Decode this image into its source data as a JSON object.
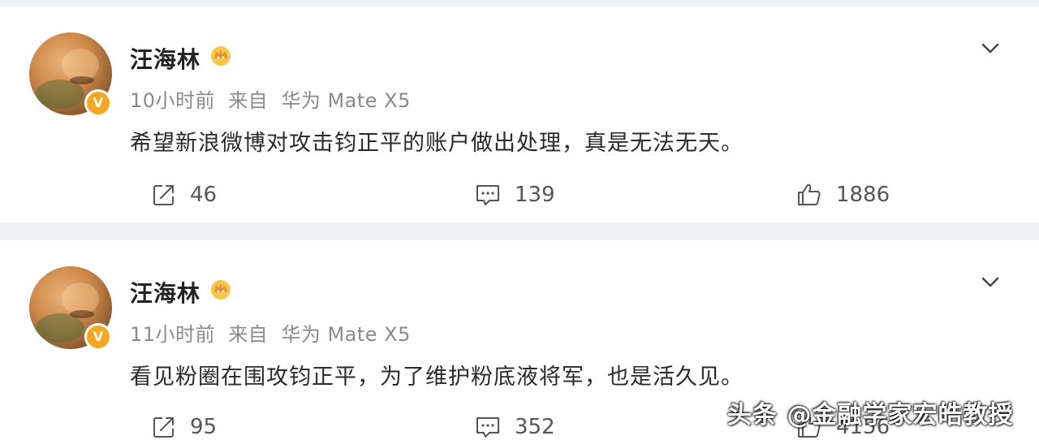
{
  "posts": [
    {
      "username": "汪海林",
      "time": "10小时前",
      "source_prefix": "来自",
      "source_device": "华为 Mate X5",
      "text": "希望新浪微博对攻击钧正平的账户做出处理，真是无法无天。",
      "reposts": "46",
      "comments": "139",
      "likes": "1886",
      "verified_badge": "V"
    },
    {
      "username": "汪海林",
      "time": "11小时前",
      "source_prefix": "来自",
      "source_device": "华为 Mate X5",
      "text": "看见粉圈在围攻钧正平，为了维护粉底液将军，也是活久见。",
      "reposts": "95",
      "comments": "352",
      "likes": "4156",
      "verified_badge": "V"
    }
  ],
  "watermark": "头条 @金融学家宏皓教授",
  "colors": {
    "page_bg": "#eef0f3",
    "card_bg": "#ffffff",
    "badge": "#f5a623",
    "meta_text": "#8a8a8a"
  },
  "icons": {
    "repost": "repost-icon",
    "comment": "comment-icon",
    "like": "thumbs-up-icon",
    "more": "chevron-down-icon",
    "vip": "crown-badge-icon"
  }
}
